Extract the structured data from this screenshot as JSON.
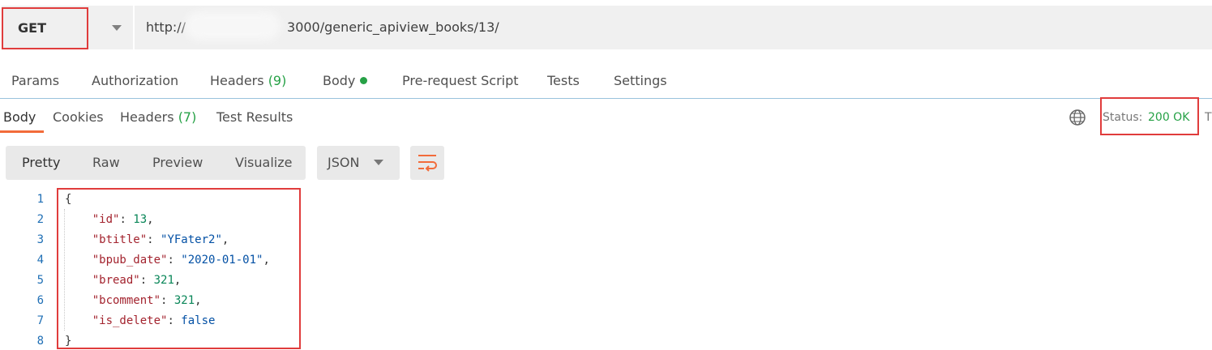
{
  "request": {
    "method": "GET",
    "url_prefix": "http://",
    "url_suffix": "3000/generic_apiview_books/13/",
    "tabs": [
      {
        "label": "Params"
      },
      {
        "label": "Authorization"
      },
      {
        "label": "Headers",
        "count": "(9)"
      },
      {
        "label": "Body"
      },
      {
        "label": "Pre-request Script"
      },
      {
        "label": "Tests"
      },
      {
        "label": "Settings"
      }
    ]
  },
  "response": {
    "tabs": [
      {
        "label": "Body"
      },
      {
        "label": "Cookies"
      },
      {
        "label": "Headers",
        "count": "(7)"
      },
      {
        "label": "Test Results"
      }
    ],
    "status_label": "Status:",
    "status_value": "200 OK",
    "truncated_next": "T",
    "view_modes": [
      "Pretty",
      "Raw",
      "Preview",
      "Visualize"
    ],
    "format": "JSON",
    "lines": [
      {
        "num": "1",
        "text": "{"
      },
      {
        "num": "2",
        "key": "\"id\"",
        "value": "13",
        "vtype": "n",
        "comma": ","
      },
      {
        "num": "3",
        "key": "\"btitle\"",
        "value": "\"YFater2\"",
        "vtype": "s",
        "comma": ","
      },
      {
        "num": "4",
        "key": "\"bpub_date\"",
        "value": "\"2020-01-01\"",
        "vtype": "s",
        "comma": ","
      },
      {
        "num": "5",
        "key": "\"bread\"",
        "value": "321",
        "vtype": "n",
        "comma": ","
      },
      {
        "num": "6",
        "key": "\"bcomment\"",
        "value": "321",
        "vtype": "n",
        "comma": ","
      },
      {
        "num": "7",
        "key": "\"is_delete\"",
        "value": "false",
        "vtype": "b",
        "comma": ""
      },
      {
        "num": "8",
        "text": "}"
      }
    ]
  },
  "icons": {
    "globe": "globe-icon",
    "wrap": "wrap-lines-icon",
    "caret": "chevron-down-icon"
  },
  "colors": {
    "accent_orange": "#f26b3a",
    "status_green": "#26a146",
    "highlight_red": "#e03c3c"
  }
}
